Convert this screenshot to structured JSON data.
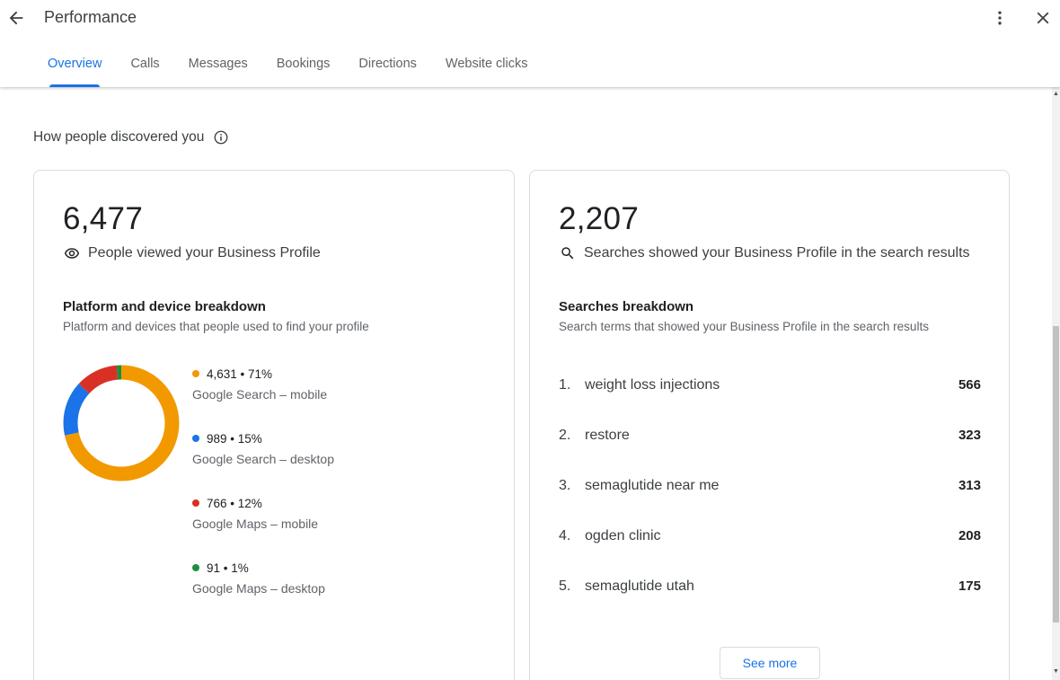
{
  "header": {
    "title": "Performance",
    "tabs": [
      {
        "label": "Overview",
        "active": true
      },
      {
        "label": "Calls"
      },
      {
        "label": "Messages"
      },
      {
        "label": "Bookings"
      },
      {
        "label": "Directions"
      },
      {
        "label": "Website clicks"
      }
    ]
  },
  "section": {
    "title": "How people discovered you",
    "info_icon": "info-icon"
  },
  "views_card": {
    "total": "6,477",
    "total_label": "People viewed your Business Profile",
    "total_icon": "eye-icon",
    "breakdown_title": "Platform and device breakdown",
    "breakdown_desc": "Platform and devices that people used to find your profile",
    "segments": [
      {
        "value": "4,631 • 71%",
        "label": "Google Search – mobile",
        "count": 4631,
        "percent": 71,
        "color": "#f29900"
      },
      {
        "value": "989 • 15%",
        "label": "Google Search – desktop",
        "count": 989,
        "percent": 15,
        "color": "#1a73e8"
      },
      {
        "value": "766 • 12%",
        "label": "Google Maps – mobile",
        "count": 766,
        "percent": 12,
        "color": "#d93025"
      },
      {
        "value": "91 • 1%",
        "label": "Google Maps – desktop",
        "count": 91,
        "percent": 1,
        "color": "#1e8e3e"
      }
    ]
  },
  "searches_card": {
    "total": "2,207",
    "total_label": "Searches showed your Business Profile in the search results",
    "total_icon": "search-icon",
    "breakdown_title": "Searches breakdown",
    "breakdown_desc": "Search terms that showed your Business Profile in the search results",
    "terms": [
      {
        "rank": "1.",
        "term": "weight loss injections",
        "count": "566"
      },
      {
        "rank": "2.",
        "term": "restore",
        "count": "323"
      },
      {
        "rank": "3.",
        "term": "semaglutide near me",
        "count": "313"
      },
      {
        "rank": "4.",
        "term": "ogden clinic",
        "count": "208"
      },
      {
        "rank": "5.",
        "term": "semaglutide utah",
        "count": "175"
      }
    ],
    "see_more_label": "See more"
  }
}
